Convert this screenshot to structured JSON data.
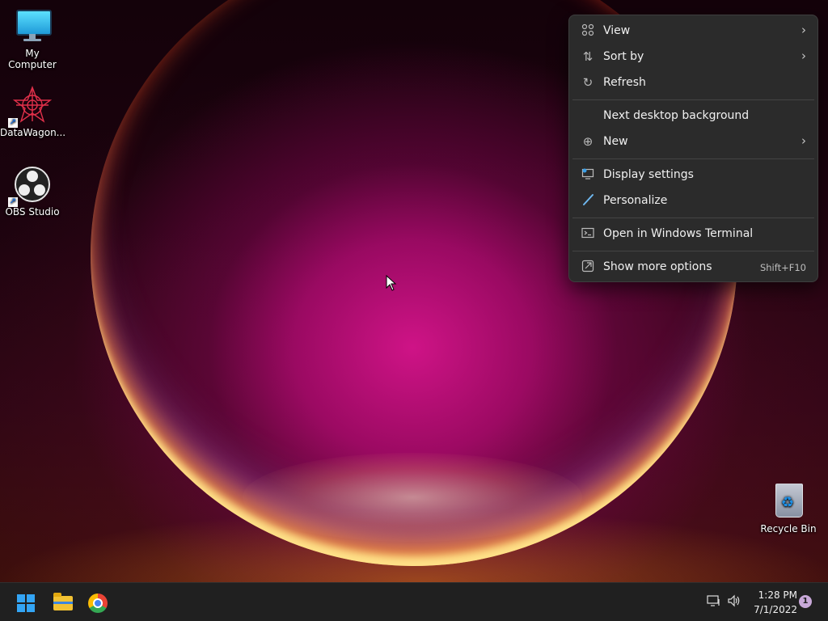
{
  "desktop": {
    "icons": [
      {
        "label": "My Computer",
        "icon": "computer-icon",
        "shortcut": false
      },
      {
        "label": "DataWagon...",
        "icon": "datawagon-icon",
        "shortcut": true
      },
      {
        "label": "OBS Studio",
        "icon": "obs-icon",
        "shortcut": true
      },
      {
        "label": "Recycle Bin",
        "icon": "recycle-bin-icon",
        "shortcut": false
      }
    ]
  },
  "context_menu": {
    "items": [
      {
        "label": "View",
        "icon": "grid-icon",
        "submenu": true
      },
      {
        "label": "Sort by",
        "icon": "sort-icon",
        "submenu": true
      },
      {
        "label": "Refresh",
        "icon": "refresh-icon"
      },
      {
        "label": "Next desktop background",
        "icon": ""
      },
      {
        "label": "New",
        "icon": "plus-circle-icon",
        "submenu": true
      },
      {
        "label": "Display settings",
        "icon": "display-icon"
      },
      {
        "label": "Personalize",
        "icon": "brush-icon"
      },
      {
        "label": "Open in Windows Terminal",
        "icon": "terminal-icon"
      },
      {
        "label": "Show more options",
        "icon": "expand-icon",
        "shortcut": "Shift+F10"
      }
    ]
  },
  "taskbar": {
    "buttons": [
      {
        "name": "start",
        "icon": "windows-logo-icon"
      },
      {
        "name": "file-explorer",
        "icon": "folder-icon"
      },
      {
        "name": "chrome",
        "icon": "chrome-icon"
      }
    ],
    "tray": {
      "time": "1:28 PM",
      "date": "7/1/2022",
      "notification_count": "1"
    }
  },
  "colors": {
    "menu_bg": "#2b2b2b",
    "taskbar_bg": "#202020",
    "accent": "#33a5f5"
  }
}
